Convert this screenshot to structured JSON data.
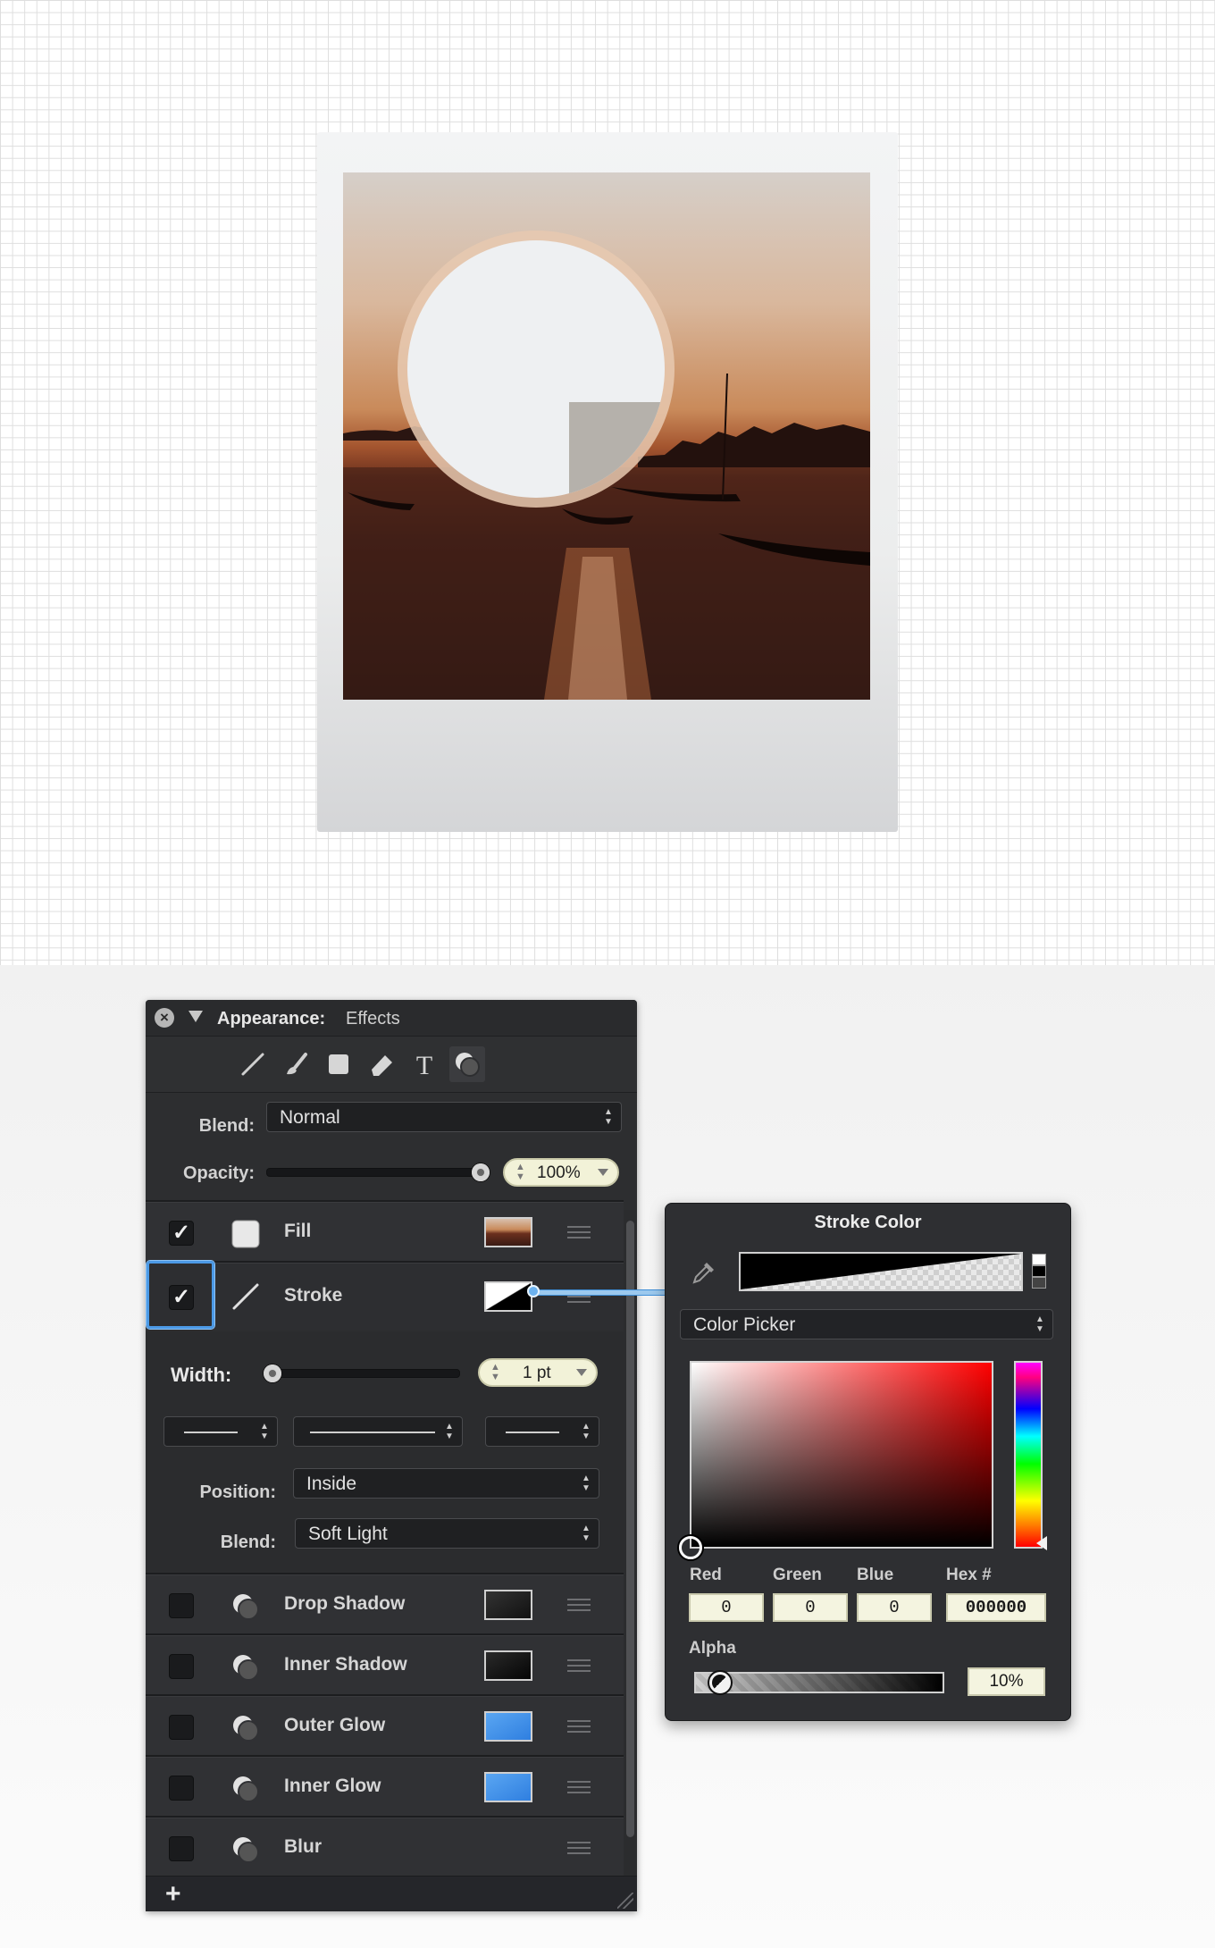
{
  "canvas": {
    "grid_color": "#dedede",
    "artwork": {
      "photo_description_alt": "",
      "colors": {
        "sky_top": "#d6cfc9",
        "sun_glow": "#c98a5a",
        "water_dark": "#2e1712",
        "disc": "#eef0f2",
        "disc_rect": "#b5b1ab",
        "ring": "#e8c9b0"
      }
    }
  },
  "appearance_panel": {
    "title_label": "Appearance:",
    "title_value": "Effects",
    "toolbar_icons": [
      "stroke-tool-icon",
      "brush-tool-icon",
      "fill-tool-icon",
      "eraser-tool-icon",
      "text-tool-icon",
      "effects-tool-icon"
    ],
    "blend_label": "Blend:",
    "blend_value": "Normal",
    "opacity_label": "Opacity:",
    "opacity_value": "100%",
    "opacity_fraction": 1.0,
    "effects": [
      {
        "name": "Fill",
        "checked": true,
        "swatch": "photo"
      },
      {
        "name": "Stroke",
        "checked": true,
        "swatch": "black-white-diagonal"
      },
      {
        "name": "Drop Shadow",
        "checked": false,
        "swatch": "#1a1a1a"
      },
      {
        "name": "Inner Shadow",
        "checked": false,
        "swatch": "#111111"
      },
      {
        "name": "Outer Glow",
        "checked": false,
        "swatch": "#3d8fe8"
      },
      {
        "name": "Inner Glow",
        "checked": false,
        "swatch": "#3d8fe8"
      },
      {
        "name": "Blur",
        "checked": false,
        "swatch": ""
      }
    ],
    "stroke": {
      "width_label": "Width:",
      "width_value": "1 pt",
      "position_label": "Position:",
      "position_value": "Inside",
      "blend_label": "Blend:",
      "blend_value": "Soft Light"
    },
    "accent": "#4c9ae6"
  },
  "stroke_color": {
    "title": "Stroke Color",
    "mode": "Color Picker",
    "labels": {
      "red": "Red",
      "green": "Green",
      "blue": "Blue",
      "hex": "Hex #",
      "alpha": "Alpha"
    },
    "values": {
      "red": "0",
      "green": "0",
      "blue": "0",
      "hex": "000000",
      "alpha": "10%"
    },
    "hue_color": "#ff0000"
  }
}
